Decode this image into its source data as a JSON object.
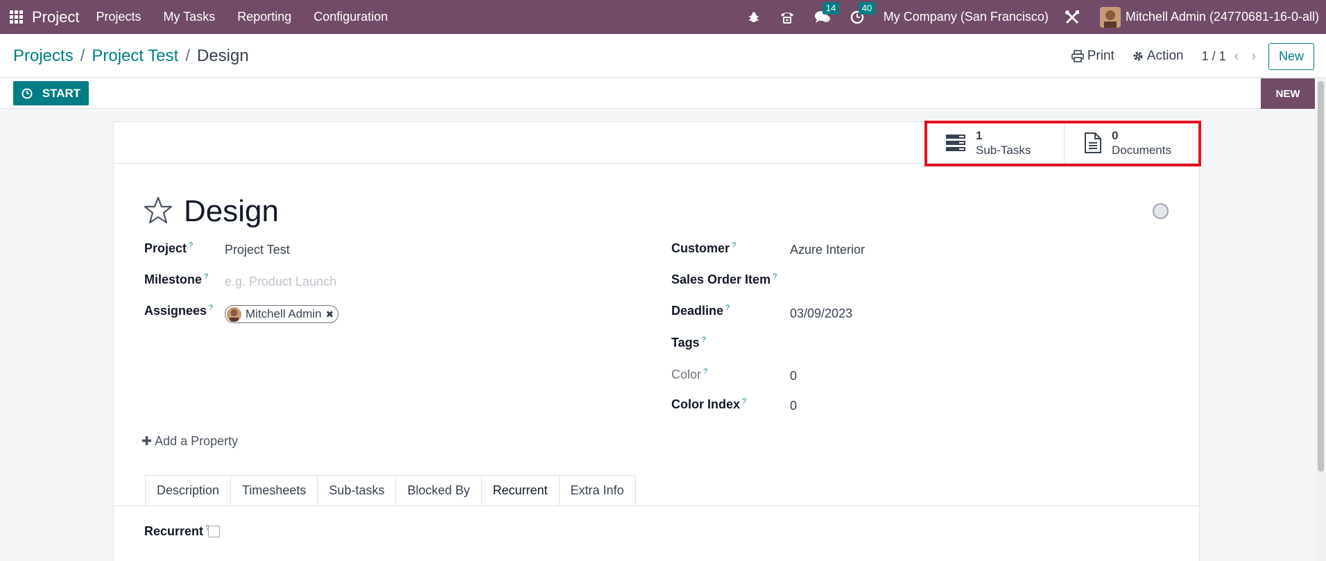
{
  "navbar": {
    "brand": "Project",
    "menu": [
      "Projects",
      "My Tasks",
      "Reporting",
      "Configuration"
    ],
    "messages_count": "14",
    "activities_count": "40",
    "company": "My Company (San Francisco)",
    "user": "Mitchell Admin (24770681-16-0-all)"
  },
  "breadcrumb": {
    "items": [
      "Projects",
      "Project Test"
    ],
    "current": "Design",
    "separator": "/"
  },
  "control": {
    "print": "Print",
    "action": "Action",
    "pager": "1 / 1",
    "new": "New"
  },
  "statusbar": {
    "start": "START",
    "stage": "NEW"
  },
  "smart_buttons": {
    "subtasks": {
      "value": "1",
      "label": "Sub-Tasks"
    },
    "documents": {
      "value": "0",
      "label": "Documents"
    }
  },
  "task": {
    "title": "Design"
  },
  "fields": {
    "project": {
      "label": "Project",
      "value": "Project Test"
    },
    "milestone": {
      "label": "Milestone",
      "placeholder": "e.g. Product Launch"
    },
    "assignees": {
      "label": "Assignees",
      "value": "Mitchell Admin"
    },
    "customer": {
      "label": "Customer",
      "value": "Azure Interior"
    },
    "sales_order_item": {
      "label": "Sales Order Item"
    },
    "deadline": {
      "label": "Deadline",
      "value": "03/09/2023"
    },
    "tags": {
      "label": "Tags"
    },
    "color": {
      "label": "Color",
      "value": "0"
    },
    "color_index": {
      "label": "Color Index",
      "value": "0"
    },
    "help_marker": "?"
  },
  "add_property": "Add a Property",
  "tabs": [
    "Description",
    "Timesheets",
    "Sub-tasks",
    "Blocked By",
    "Recurrent",
    "Extra Info"
  ],
  "recurrent": {
    "label": "Recurrent"
  },
  "colors": {
    "brand": "#714b67",
    "primary": "#017e84",
    "highlight": "#e3121f"
  }
}
